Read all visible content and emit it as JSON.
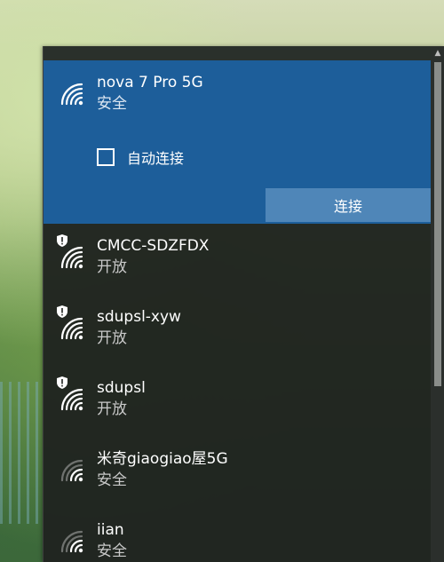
{
  "networks": [
    {
      "ssid": "nova 7 Pro 5G",
      "status": "安全",
      "icon": "wifi-icon",
      "secured": true,
      "selected": true
    },
    {
      "ssid": "CMCC-SDZFDX",
      "status": "开放",
      "icon": "wifi-shield-icon",
      "secured": false
    },
    {
      "ssid": "sdupsl-xyw",
      "status": "开放",
      "icon": "wifi-shield-icon",
      "secured": false
    },
    {
      "ssid": "sdupsl",
      "status": "开放",
      "icon": "wifi-shield-icon",
      "secured": false
    },
    {
      "ssid": "米奇giaogiao屋5G",
      "status": "安全",
      "icon": "wifi-icon",
      "secured": true
    },
    {
      "ssid": "iian",
      "status": "安全",
      "icon": "wifi-icon",
      "secured": true
    }
  ],
  "selected_network": {
    "auto_connect_label": "自动连接",
    "auto_connect_checked": false,
    "connect_label": "连接"
  },
  "colors": {
    "selected_bg": "#1d5e9a",
    "panel_bg": "#202420",
    "connect_button": "#4f86b8"
  }
}
